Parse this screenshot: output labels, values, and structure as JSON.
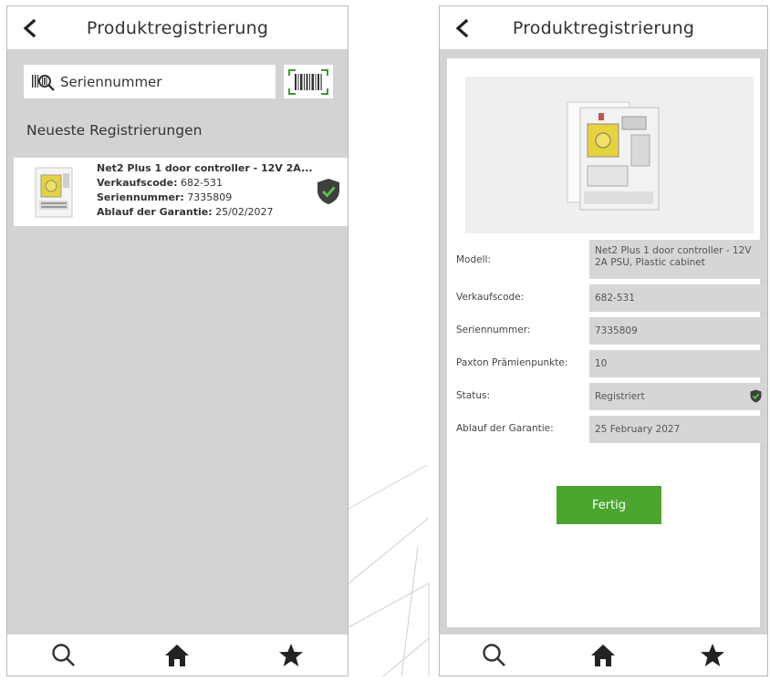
{
  "left_screen": {
    "header": {
      "title": "Produktregistrierung"
    },
    "search": {
      "placeholder": "Seriennummer"
    },
    "section_title": "Neueste Registrierungen",
    "registration": {
      "product_name": "Net2 Plus 1 door controller - 12V 2A...",
      "sales_code_label": "Verkaufscode:",
      "sales_code": "682-531",
      "serial_label": "Seriennummer:",
      "serial": "7335809",
      "warranty_label": "Ablauf der Garantie:",
      "warranty": "25/02/2027"
    }
  },
  "right_screen": {
    "header": {
      "title": "Produktregistrierung"
    },
    "fields": {
      "model_label": "Modell:",
      "model_value": "Net2 Plus 1 door controller - 12V 2A PSU, Plastic cabinet",
      "sales_code_label": "Verkaufscode:",
      "sales_code_value": "682-531",
      "serial_label": "Seriennummer:",
      "serial_value": "7335809",
      "points_label": "Paxton Prämienpunkte:",
      "points_value": "10",
      "status_label": "Status:",
      "status_value": "Registriert",
      "warranty_label": "Ablauf der Garantie:",
      "warranty_value": "25 February 2027"
    },
    "done_button": "Fertig"
  },
  "nav_icons": [
    "search-icon",
    "home-icon",
    "star-icon"
  ],
  "colors": {
    "accent_green": "#4aa52e",
    "shield_dark": "#3f3f3f",
    "gray_bg": "#d3d3d3"
  }
}
